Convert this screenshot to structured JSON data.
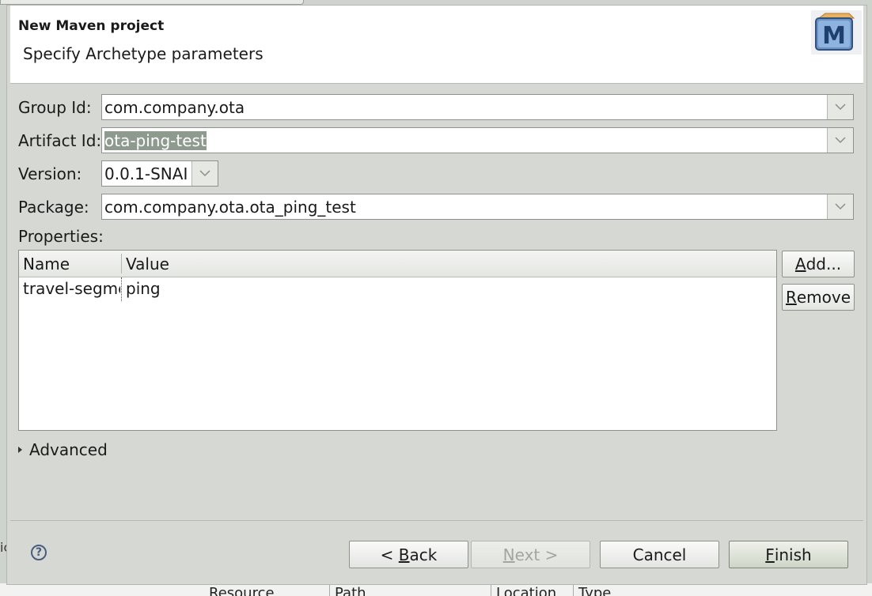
{
  "dialog": {
    "title": "New Maven project",
    "subtitle": "Specify Archetype parameters",
    "logo_letter": "M"
  },
  "fields": {
    "group_id": {
      "label": "Group Id:",
      "value": "com.company.ota"
    },
    "artifact_id": {
      "label": "Artifact Id:",
      "value": "ota-ping-test"
    },
    "version": {
      "label": "Version:",
      "value": "0.0.1-SNAI"
    },
    "package": {
      "label": "Package:",
      "value": "com.company.ota.ota_ping_test"
    }
  },
  "properties": {
    "label": "Properties:",
    "columns": [
      "Name",
      "Value"
    ],
    "rows": [
      {
        "name": "travel-segme",
        "value": "ping"
      }
    ],
    "add_prefix": "",
    "add_mnemonic": "A",
    "add_suffix": "dd...",
    "remove_prefix": "",
    "remove_mnemonic": "R",
    "remove_suffix": "emove"
  },
  "advanced": {
    "prefix": "Ad",
    "mnemonic": "v",
    "suffix": "anced"
  },
  "footer": {
    "help_icon": "?",
    "back_prefix": "< ",
    "back_mnemonic": "B",
    "back_suffix": "ack",
    "next_prefix": "",
    "next_mnemonic": "N",
    "next_suffix": "ext >",
    "cancel_label": "Cancel",
    "finish_prefix": "",
    "finish_mnemonic": "F",
    "finish_suffix": "inish"
  },
  "background": {
    "left_stub": "ic",
    "columns": [
      "Resource",
      "Path",
      "Location",
      "Type"
    ]
  },
  "icons": [
    "maven-logo-icon",
    "dropdown-chevron-icon",
    "expand-triangle-icon",
    "help-icon"
  ],
  "colors": {
    "dialog_bg": "#d6d9d3",
    "header_bg": "#ffffff",
    "selection": "#8f9a8f",
    "help": "#4a5d7e"
  }
}
